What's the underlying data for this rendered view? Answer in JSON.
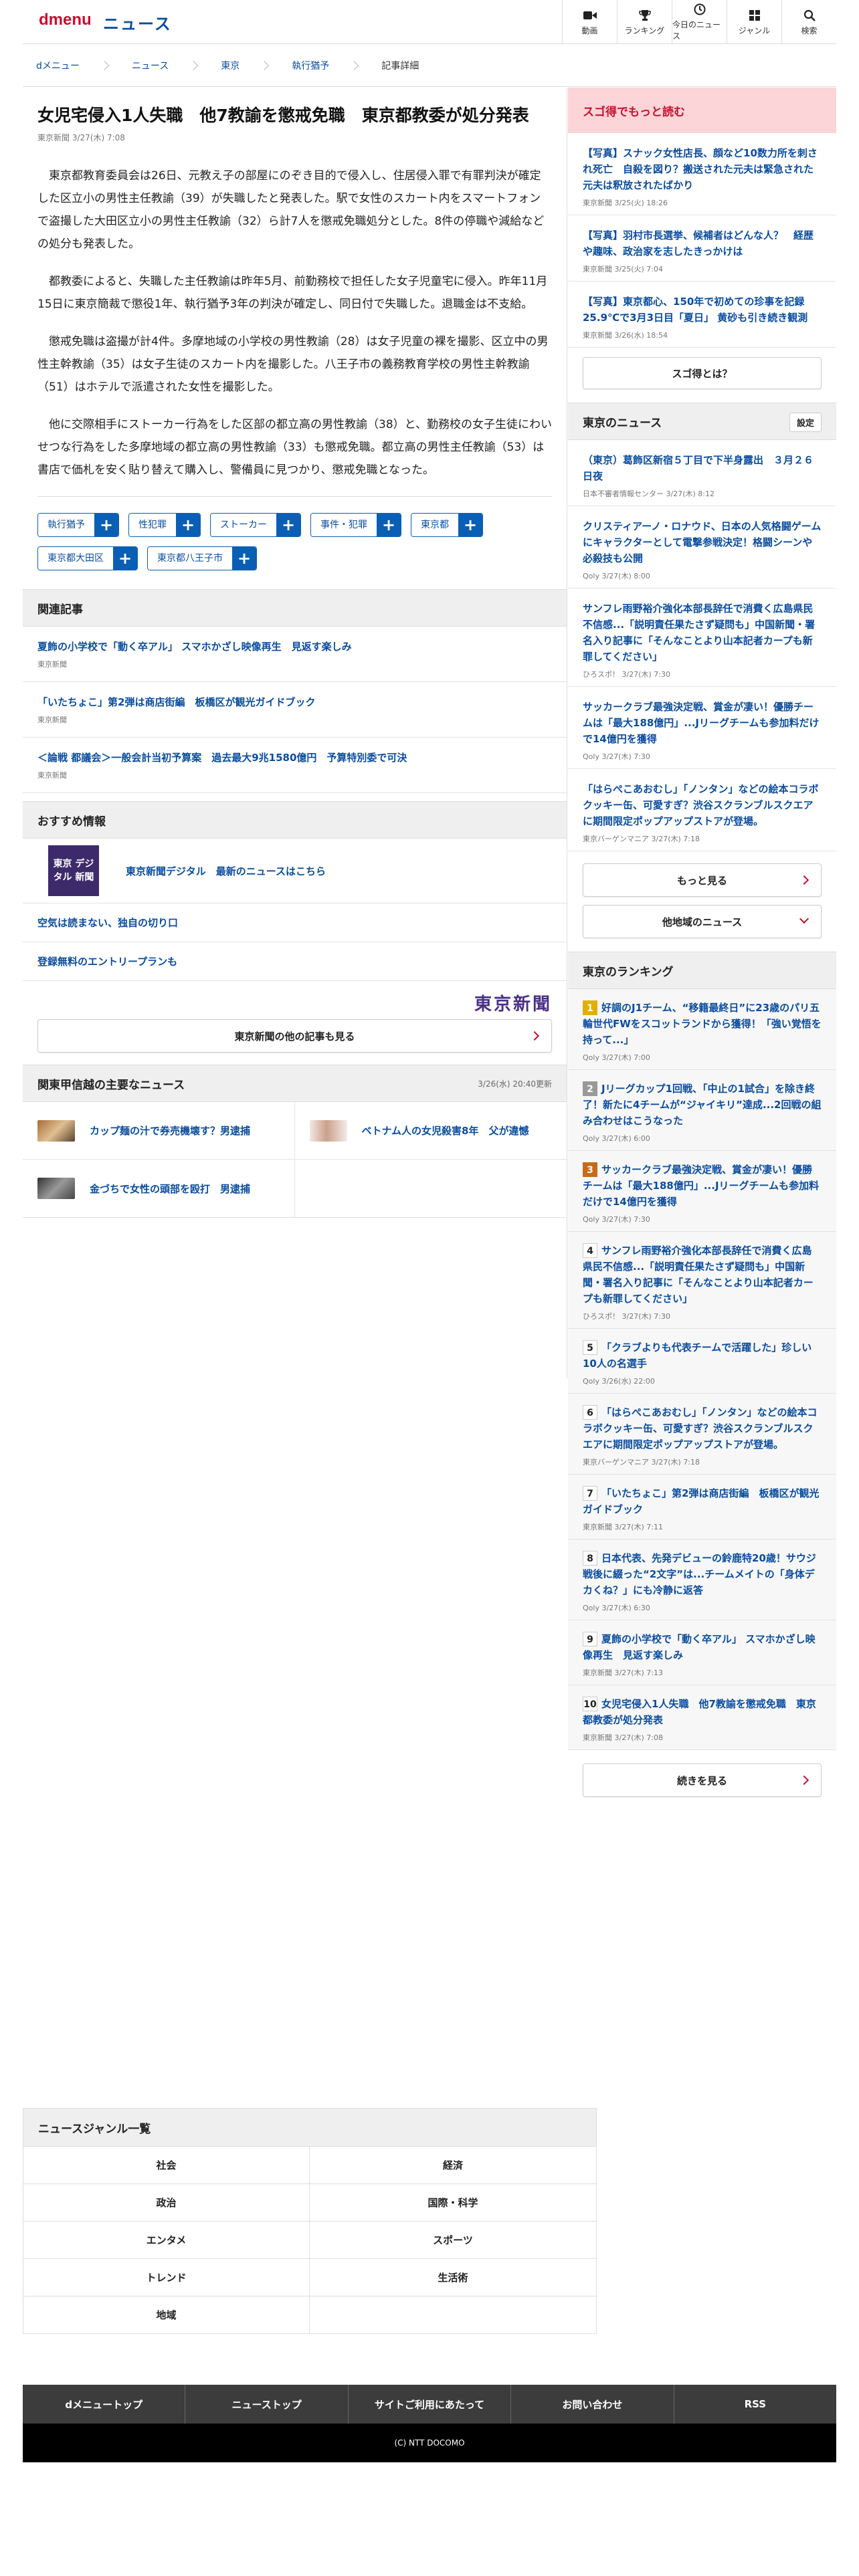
{
  "header": {
    "logo": "dmenu",
    "section": "ニュース",
    "nav": [
      {
        "label": "動画",
        "icon": "video-icon"
      },
      {
        "label": "ランキング",
        "icon": "trophy-icon"
      },
      {
        "label": "今日のニュース",
        "icon": "clock-icon"
      },
      {
        "label": "ジャンル",
        "icon": "grid-icon"
      },
      {
        "label": "検索",
        "icon": "search-icon"
      }
    ]
  },
  "breadcrumb": [
    "dメニュー",
    "ニュース",
    "東京",
    "執行猶予",
    "記事詳細"
  ],
  "article": {
    "title": "女児宅侵入1人失職　他7教諭を懲戒免職　東京都教委が処分発表",
    "meta": "東京新聞 3/27(木) 7:08",
    "paragraphs": [
      "東京都教育委員会は26日、元教え子の部屋にのぞき目的で侵入し、住居侵入罪で有罪判決が確定した区立小の男性主任教諭（39）が失職したと発表した。駅で女性のスカート内をスマートフォンで盗撮した大田区立小の男性主任教諭（32）ら計7人を懲戒免職処分とした。8件の停職や減給などの処分も発表した。",
      "都教委によると、失職した主任教諭は昨年5月、前勤務校で担任した女子児童宅に侵入。昨年11月15日に東京簡裁で懲役1年、執行猶予3年の判決が確定し、同日付で失職した。退職金は不支給。",
      "懲戒免職は盗撮が計4件。多摩地域の小学校の男性教諭（28）は女子児童の裸を撮影、区立中の男性主幹教諭（35）は女子生徒のスカート内を撮影した。八王子市の義務教育学校の男性主幹教諭（51）はホテルで派遣された女性を撮影した。",
      "他に交際相手にストーカー行為をした区部の都立高の男性教諭（38）と、勤務校の女子生徒にわいせつな行為をした多摩地域の都立高の男性教諭（33）も懲戒免職。都立高の男性主任教諭（53）は書店で価札を安く貼り替えて購入し、警備員に見つかり、懲戒免職となった。"
    ],
    "tags": [
      "執行猶予",
      "性犯罪",
      "ストーカー",
      "事件・犯罪",
      "東京都",
      "東京都大田区",
      "東京都八王子市"
    ]
  },
  "related": {
    "heading": "関連記事",
    "items": [
      {
        "title": "夏飾の小学校で「動く卒アル」 スマホかざし映像再生　見返す楽しみ",
        "source": "東京新聞"
      },
      {
        "title": "「いたちょこ」第2弾は商店街編　板橋区が観光ガイドブック",
        "source": "東京新聞"
      },
      {
        "title": "＜論戦 都議会＞一般会計当初予算案　過去最大9兆1580億円　予算特別委で可決",
        "source": "東京新聞"
      }
    ]
  },
  "recommend": {
    "heading": "おすすめ情報",
    "promo_logo": "東京 デジタル 新聞",
    "promo_text": "東京新聞デジタル　最新のニュースはこちら",
    "links": [
      "空気は読まない、独自の切り口",
      "登録無料のエントリープランも"
    ],
    "brand": "東京新聞",
    "more_button": "東京新聞の他の記事も見る"
  },
  "kanto": {
    "heading": "関東甲信越の主要なニュース",
    "updated": "3/26(水) 20:40更新",
    "items": [
      {
        "title": "カップ麺の汁で券売機壊す？男逮捕"
      },
      {
        "title": "ベトナム人の女児殺害8年　父が違憾"
      },
      {
        "title": "金づちで女性の頭部を殴打　男逮捕"
      }
    ]
  },
  "sugotoku": {
    "heading": "スゴ得でもっと読む",
    "items": [
      {
        "title": "【写真】スナック女性店長、顔など10数力所を刺され死亡　自殺を図り？搬送された元夫は緊急された元夫は釈放されたばかり",
        "meta": "東京新聞 3/25(火) 18:26"
      },
      {
        "title": "【写真】羽村市長選挙、候補者はどんな人？　経歴や趣味、政治家を志したきっかけは",
        "meta": "東京新聞 3/25(火) 7:04"
      },
      {
        "title": "【写真】東京都心、150年で初めての珍事を記録　25.9℃で3月3日目「夏日」 黄砂も引き続き観測",
        "meta": "東京新聞 3/26(水) 18:54"
      }
    ],
    "button": "スゴ得とは？"
  },
  "tokyo_news": {
    "heading": "東京のニュース",
    "settings": "設定",
    "items": [
      {
        "title": "（東京）葛飾区新宿５丁目で下半身露出　３月２６日夜",
        "meta": "日本不審者情報センター 3/27(木) 8:12"
      },
      {
        "title": "クリスティアーノ・ロナウド、日本の人気格闘ゲームにキャラクターとして電撃参戦決定！格闘シーンや必殺技も公開",
        "meta": "Qoly 3/27(木) 8:00"
      },
      {
        "title": "サンフレ雨野裕介強化本部長辞任で消費く広島県民不信感...「説明責任果たさず疑問も」中国新聞・署名入り記事に「そんなことより山本記者カープも新罪してください」",
        "meta": "ひろスポ！ 3/27(木) 7:30"
      },
      {
        "title": "サッカークラブ最強決定戦、賞金が凄い！優勝チームは「最大188億円」...Jリーグチームも参加料だけで14億円を獲得",
        "meta": "Qoly 3/27(木) 7:30"
      },
      {
        "title": "「はらぺこあおむし」「ノンタン」などの絵本コラボクッキー缶、可愛すぎ？渋谷スクランブルスクエアに期間限定ポップアップストアが登場。",
        "meta": "東京バーゲンマニア 3/27(木) 7:18"
      }
    ],
    "more_button": "もっと見る",
    "other_button": "他地域のニュース"
  },
  "ranking": {
    "heading": "東京のランキング",
    "items": [
      {
        "rank": "1",
        "title": "好調のJ1チーム、“移籍最終日”に23歳のパリ五輪世代FWをスコットランドから獲得！「強い覚悟を持って...」",
        "meta": "Qoly 3/27(木) 7:00"
      },
      {
        "rank": "2",
        "title": "Jリーグカップ1回戦、「中止の1試合」を除き終了！新たに4チームが“ジャイキリ”達成...2回戦の組み合わせはこうなった",
        "meta": "Qoly 3/27(木) 6:00"
      },
      {
        "rank": "3",
        "title": "サッカークラブ最強決定戦、賞金が凄い！優勝チームは「最大188億円」...Jリーグチームも参加料だけで14億円を獲得",
        "meta": "Qoly 3/27(木) 7:30"
      },
      {
        "rank": "4",
        "title": "サンフレ雨野裕介強化本部長辞任で消費く広島県民不信感...「説明責任果たさず疑問も」中国新聞・署名入り記事に「そんなことより山本記者カープも新罪してください」",
        "meta": "ひろスポ！ 3/27(木) 7:30"
      },
      {
        "rank": "5",
        "title": "「クラブよりも代表チームで活躍した」珍しい10人の名選手",
        "meta": "Qoly 3/26(水) 22:00"
      },
      {
        "rank": "6",
        "title": "「はらぺこあおむし」「ノンタン」などの絵本コラボクッキー缶、可愛すぎ？渋谷スクランブルスクエアに期間限定ポップアップストアが登場。",
        "meta": "東京バーゲンマニア 3/27(木) 7:18"
      },
      {
        "rank": "7",
        "title": "「いたちょこ」第2弾は商店街編　板橋区が観光ガイドブック",
        "meta": "東京新聞 3/27(木) 7:11"
      },
      {
        "rank": "8",
        "title": "日本代表、先発デビューの鈴鹿特20歳！サウジ戦後に綴った“2文字”は...チームメイトの「身体デカくね？」にも冷静に返答",
        "meta": "Qoly 3/27(木) 6:30"
      },
      {
        "rank": "9",
        "title": "夏飾の小学校で「動く卒アル」 スマホかざし映像再生　見返す楽しみ",
        "meta": "東京新聞 3/27(木) 7:13"
      },
      {
        "rank": "10",
        "title": "女児宅侵入1人失職　他7教諭を懲戒免職　東京都教委が処分発表",
        "meta": "東京新聞 3/27(木) 7:08"
      }
    ],
    "more_button": "続きを見る"
  },
  "genres": {
    "heading": "ニュースジャンル一覧",
    "items": [
      "社会",
      "経済",
      "政治",
      "国際・科学",
      "エンタメ",
      "スポーツ",
      "トレンド",
      "生活術",
      "地域"
    ]
  },
  "footer": {
    "links": [
      "dメニュートップ",
      "ニューストップ",
      "サイトご利用にあたって",
      "お問い合わせ",
      "RSS"
    ],
    "copyright": "(C) NTT DOCOMO"
  },
  "colors": {
    "accent": "#c8102e",
    "link": "#0a4c9e",
    "tag": "#0a5fb4",
    "sugotoku_bg": "#fbd5d8"
  }
}
